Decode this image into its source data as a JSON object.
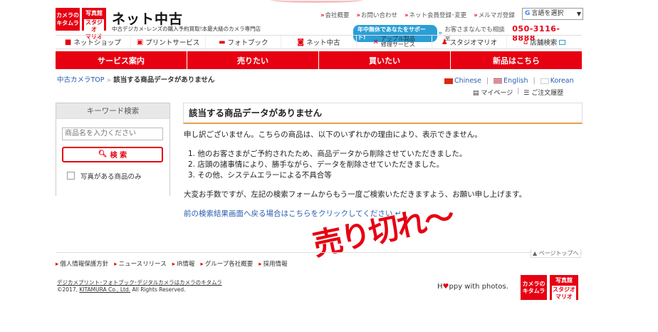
{
  "header": {
    "logo_kitamura": "カメラの\nキタムラ",
    "logo_mario": "スタジオ\nマリオ",
    "logo_mario_top": "写真館",
    "site_title": "ネット中古",
    "tagline": "中古デジカメ･レンズの購入予約買取!本最大級のカメラ専門店",
    "util_links": [
      "会社概要",
      "お問い合わせ",
      "ネット会員登録･変更",
      "メルマガ登録"
    ],
    "lang_select": "言語を選択",
    "support_badge": "年中無休であなたをサポート!",
    "support_text": "お客さまなんでも相談室",
    "phone": "050-3116-8888"
  },
  "service_bar": [
    {
      "label": "ネットショップ",
      "icon": "shop-icon"
    },
    {
      "label": "プリントサービス",
      "icon": "print-icon"
    },
    {
      "label": "フォトブック",
      "icon": "photobook-icon"
    },
    {
      "label": "ネット中古",
      "icon": "camera-icon"
    },
    {
      "label": "アップル製品修理サービス",
      "label1": "アップル製品",
      "label2": "修理サービス",
      "icon": "repair-icon"
    },
    {
      "label": "スタジオマリオ",
      "icon": "studio-icon"
    },
    {
      "label": "店舗検索",
      "icon": "store-icon"
    }
  ],
  "nav": [
    "サービス案内",
    "売りたい",
    "買いたい",
    "新品はこちら"
  ],
  "breadcrumb": {
    "home": "中古カメラTOP",
    "current": "該当する商品データがありません"
  },
  "languages": [
    "Chinese",
    "English",
    "Korean"
  ],
  "my_links": {
    "mypage": "マイページ",
    "history": "ご注文履歴"
  },
  "sidebar": {
    "title": "キーワード検索",
    "search_placeholder": "商品名を入力ください",
    "search_button": "検 索",
    "photo_only": "写真がある商品のみ"
  },
  "main": {
    "heading": "該当する商品データがありません",
    "intro": "申し訳ございません。こちらの商品は、以下のいずれかの理由により、表示できません。",
    "reasons": [
      "1. 他のお客さまがご予約されたため、商品データから削除させていただきました。",
      "2. 店頭の諸事情により、勝手ながら、データを削除させていただきました。",
      "3. その他、システムエラーによる不具合等"
    ],
    "closing": "大変お手数ですが、左記の検索フォームからもう一度ご検索いただきますよう、お願い申し上げます。",
    "back_link": "前の検索結果画面へ戻る場合はこちらをクリックしてください"
  },
  "stamp": "売り切れ〜",
  "footer": {
    "page_top": "ページトップへ",
    "links": [
      "個人情報保護方針",
      "ニュースリリース",
      "IR情報",
      "グループ各社概要",
      "採用情報"
    ],
    "brands": "デジカメプリント･フォトブック･デジタルカメラ",
    "brands_suffix": "はカメラのキタムラ",
    "copyright_prefix": "©2017, ",
    "copyright_company": "KITAMURA Co., Ltd.",
    "copyright_suffix": " All Rights Reserved.",
    "happy_pre": "H",
    "happy_heart": "♥",
    "happy_post": "ppy with photos.",
    "logo_kitamura": "カメラの\nキタムラ",
    "logo_mario": "スタジオ\nマリオ",
    "logo_mario_top": "写真館"
  }
}
